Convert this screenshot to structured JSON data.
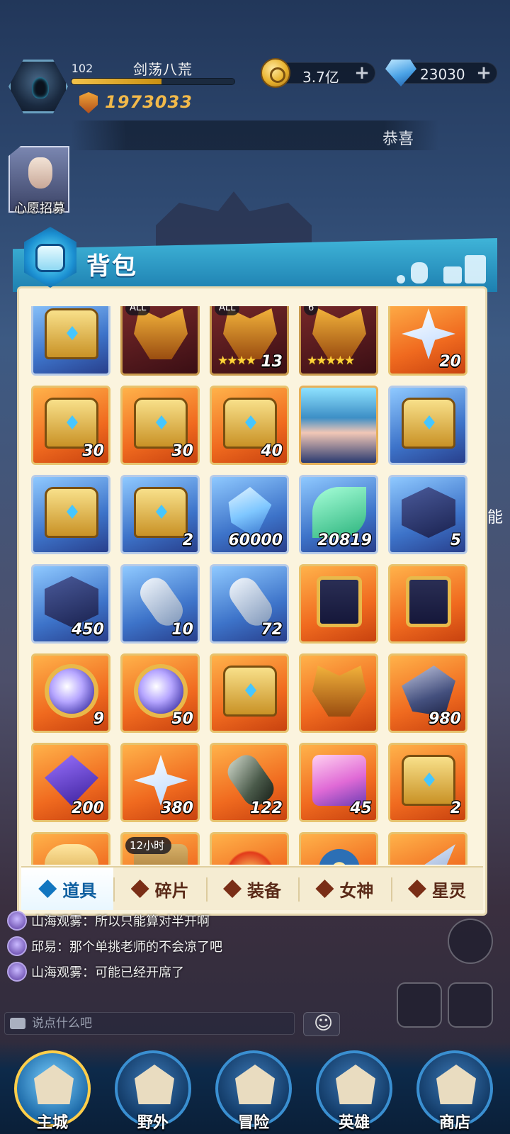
{
  "player": {
    "level": "102",
    "name": "剑荡八荒",
    "power": "1973033",
    "exp_fraction": 0.55
  },
  "currencies": {
    "gold": "3.7亿",
    "gems": "23030"
  },
  "marquee": "恭喜",
  "wish_recruit_label": "心愿招募",
  "bag": {
    "title": "背包",
    "items": [
      {
        "style": "blue",
        "art": "chest",
        "count": "",
        "badge": "",
        "stars": ""
      },
      {
        "style": "dark",
        "art": "mask",
        "count": "",
        "badge": "ALL",
        "stars": ""
      },
      {
        "style": "dark",
        "art": "mask",
        "count": "13",
        "badge": "ALL",
        "stars": "★★★★"
      },
      {
        "style": "dark",
        "art": "mask",
        "count": "",
        "badge": "6",
        "stars": "★★★★★"
      },
      {
        "style": "orange",
        "art": "star",
        "count": "20",
        "badge": "",
        "stars": ""
      },
      {
        "style": "orange",
        "art": "chest",
        "count": "30",
        "badge": "",
        "stars": ""
      },
      {
        "style": "orange",
        "art": "chest",
        "count": "30",
        "badge": "",
        "stars": ""
      },
      {
        "style": "orange",
        "art": "chest",
        "count": "40",
        "badge": "",
        "stars": ""
      },
      {
        "style": "red",
        "art": "hero",
        "count": "",
        "badge": "",
        "stars": ""
      },
      {
        "style": "blue",
        "art": "chest",
        "count": "",
        "badge": "",
        "stars": ""
      },
      {
        "style": "blue",
        "art": "chest",
        "count": "",
        "badge": "",
        "stars": ""
      },
      {
        "style": "blue",
        "art": "chest",
        "count": "2",
        "badge": "",
        "stars": ""
      },
      {
        "style": "blue",
        "art": "crystal",
        "count": "60000",
        "badge": "",
        "stars": ""
      },
      {
        "style": "blue",
        "art": "leaf",
        "count": "20819",
        "badge": "",
        "stars": ""
      },
      {
        "style": "blue",
        "art": "rune",
        "count": "5",
        "badge": "",
        "stars": ""
      },
      {
        "style": "blue",
        "art": "rune",
        "count": "450",
        "badge": "",
        "stars": ""
      },
      {
        "style": "blue",
        "art": "scroll",
        "count": "10",
        "badge": "",
        "stars": ""
      },
      {
        "style": "blue",
        "art": "scroll",
        "count": "72",
        "badge": "",
        "stars": ""
      },
      {
        "style": "orange",
        "art": "card",
        "count": "",
        "badge": "",
        "stars": ""
      },
      {
        "style": "orange",
        "art": "card",
        "count": "",
        "badge": "",
        "stars": ""
      },
      {
        "style": "orange",
        "art": "orb",
        "count": "9",
        "badge": "",
        "stars": ""
      },
      {
        "style": "orange",
        "art": "orb",
        "count": "50",
        "badge": "",
        "stars": ""
      },
      {
        "style": "orange",
        "art": "chest",
        "count": "",
        "badge": "",
        "stars": ""
      },
      {
        "style": "orange",
        "art": "mask",
        "count": "",
        "badge": "",
        "stars": ""
      },
      {
        "style": "orange",
        "art": "gemstone",
        "count": "980",
        "badge": "",
        "stars": ""
      },
      {
        "style": "orange",
        "art": "cube",
        "count": "200",
        "badge": "",
        "stars": ""
      },
      {
        "style": "orange",
        "art": "star",
        "count": "380",
        "badge": "",
        "stars": ""
      },
      {
        "style": "orange",
        "art": "cannon",
        "count": "122",
        "badge": "",
        "stars": ""
      },
      {
        "style": "orange",
        "art": "puzzle",
        "count": "45",
        "badge": "",
        "stars": ""
      },
      {
        "style": "orange",
        "art": "chest",
        "count": "2",
        "badge": "",
        "stars": ""
      },
      {
        "style": "orange",
        "art": "helm",
        "count": "",
        "badge": "",
        "stars": ""
      },
      {
        "style": "orange",
        "art": "timerchest",
        "count": "",
        "badge": "12小时",
        "stars": ""
      },
      {
        "style": "orange",
        "art": "fire",
        "count": "",
        "badge": "",
        "stars": ""
      },
      {
        "style": "orange",
        "art": "wheel",
        "count": "",
        "badge": "",
        "stars": ""
      },
      {
        "style": "orange",
        "art": "spike",
        "count": "",
        "badge": "",
        "stars": ""
      }
    ],
    "tabs": [
      {
        "label": "道具",
        "active": true
      },
      {
        "label": "碎片",
        "active": false
      },
      {
        "label": "装备",
        "active": false
      },
      {
        "label": "女神",
        "active": false
      },
      {
        "label": "星灵",
        "active": false
      }
    ]
  },
  "chat": {
    "messages": [
      {
        "text": "山海观雾：所以只能算对半开啊"
      },
      {
        "text": "邱易：那个单挑老师的不会凉了吧"
      },
      {
        "text": "山海观雾：可能已经开席了"
      }
    ],
    "input_placeholder": "说点什么吧"
  },
  "nav": [
    {
      "label": "主城",
      "active": true
    },
    {
      "label": "野外",
      "active": false
    },
    {
      "label": "冒险",
      "active": false
    },
    {
      "label": "英雄",
      "active": false
    },
    {
      "label": "商店",
      "active": false
    }
  ],
  "side_peek_text": "能"
}
